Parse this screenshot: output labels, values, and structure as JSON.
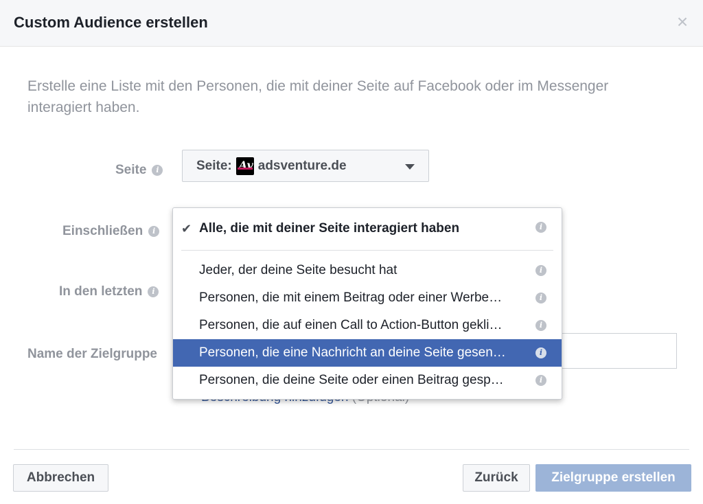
{
  "dialog": {
    "title": "Custom Audience erstellen",
    "close_label": "×",
    "intro": "Erstelle eine Liste mit den Personen, die mit deiner Seite auf Facebook oder im Messenger interagiert haben."
  },
  "form": {
    "page_label": "Seite",
    "include_label": "Einschließen",
    "last_label": "In den letzten",
    "name_label": "Name der Zielgruppe",
    "page_select": {
      "prefix": "Seite:",
      "logo_text": "Av",
      "value": "adsventure.de"
    },
    "description_link": "Beschreibung hinzufügen",
    "description_optional": "(Optional)"
  },
  "menu": {
    "items": [
      {
        "label": "Alle, die mit deiner Seite interagiert haben",
        "checked": true
      },
      {
        "label": "Jeder, der deine Seite besucht hat"
      },
      {
        "label": "Personen, die mit einem Beitrag oder einer Werbe…"
      },
      {
        "label": "Personen, die auf einen Call to Action-Button gekli…"
      },
      {
        "label": "Personen, die eine Nachricht an deine Seite gesen…",
        "selected": true
      },
      {
        "label": "Personen, die deine Seite oder einen Beitrag gesp…"
      }
    ]
  },
  "footer": {
    "cancel": "Abbrechen",
    "back": "Zurück",
    "create": "Zielgruppe erstellen"
  },
  "icons": {
    "info": "info-icon",
    "check": "check-icon",
    "caret": "caret-down-icon",
    "close": "close-icon"
  },
  "colors": {
    "selected_bg": "#4267b2",
    "link": "#365899",
    "primary_disabled": "#9cb4d8"
  }
}
